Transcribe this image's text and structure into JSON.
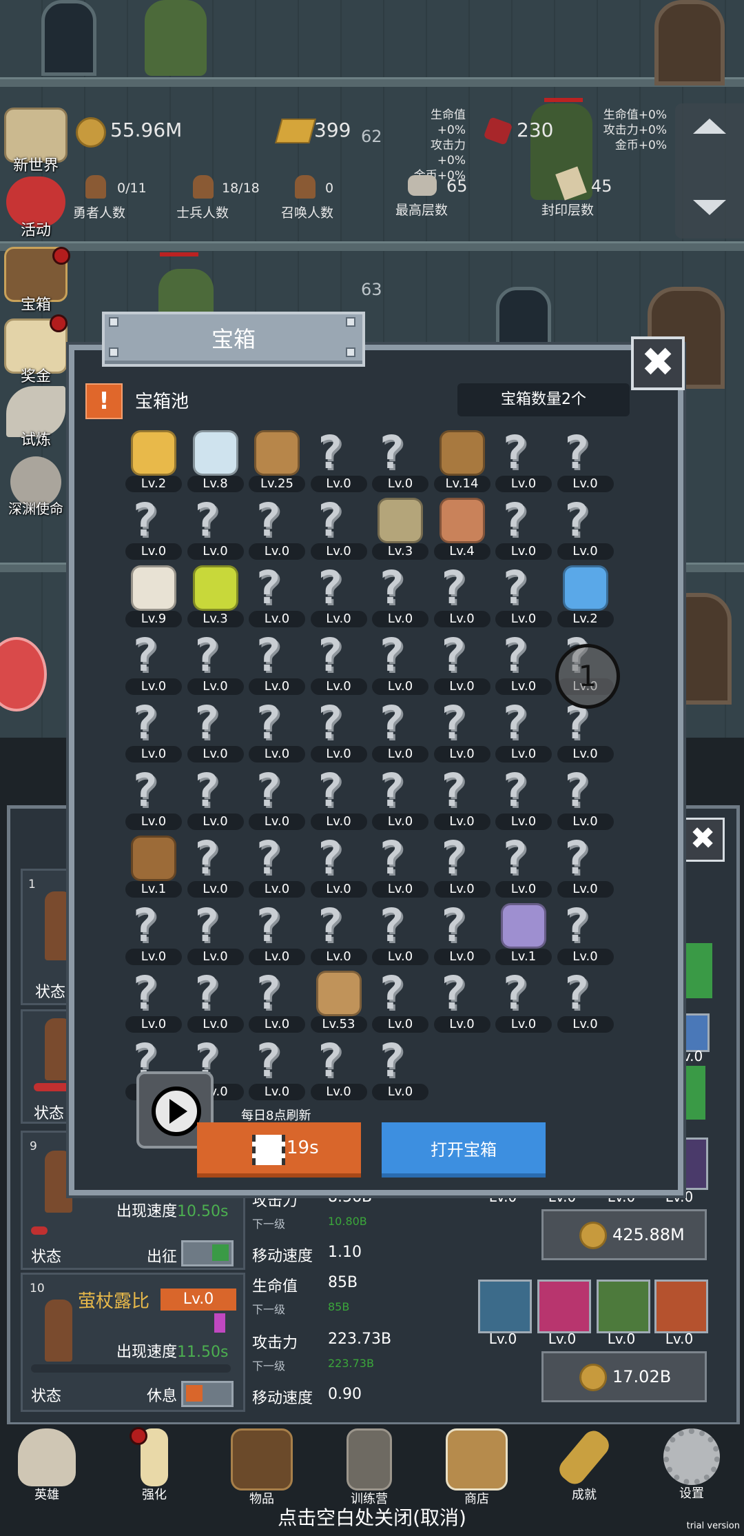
{
  "resources": {
    "gold": "55.96M",
    "gold_bars": "399",
    "gems": "230",
    "floor_62": "62",
    "floor_63": "63",
    "bonus_left": [
      "生命值+0%",
      "攻击力+0%",
      "金币+0%"
    ],
    "bonus_right": [
      "生命值+0%",
      "攻击力+0%",
      "金币+0%"
    ],
    "hero_count": "0/11",
    "hero_count_label": "勇者人数",
    "soldier_count": "18/18",
    "soldier_count_label": "士兵人数",
    "summon_count": "0",
    "summon_count_label": "召唤人数",
    "max_floor": "65",
    "max_floor_label": "最高层数",
    "seal_floor": "45",
    "seal_floor_label": "封印层数"
  },
  "side_menu": [
    {
      "label": "新世界",
      "icon": "map-icon"
    },
    {
      "label": "活动",
      "icon": "heart-icon"
    },
    {
      "label": "宝箱",
      "icon": "chest-icon"
    },
    {
      "label": "奖金",
      "icon": "envelope-icon"
    },
    {
      "label": "试炼",
      "icon": "feather-icon"
    },
    {
      "label": "深渊使命",
      "icon": "orb-icon"
    }
  ],
  "dialog": {
    "title": "宝箱",
    "close_symbol": "✖",
    "pool_icon": "!",
    "pool_title": "宝箱池",
    "chest_count": "宝箱数量2个",
    "refresh_note": "每日8点刷新",
    "video_timer": "19s",
    "open_button": "打开宝箱",
    "crosshair_number": "1",
    "unknown_symbol": "?",
    "items": [
      {
        "icon": "crown-icon",
        "lv": "Lv.2"
      },
      {
        "icon": "diamond-icon",
        "lv": "Lv.8"
      },
      {
        "icon": "sword-icon",
        "lv": "Lv.25"
      },
      {
        "icon": "unknown",
        "lv": "Lv.0"
      },
      {
        "icon": "unknown",
        "lv": "Lv.0"
      },
      {
        "icon": "chest-armor-icon",
        "lv": "Lv.14"
      },
      {
        "icon": "unknown",
        "lv": "Lv.0"
      },
      {
        "icon": "unknown",
        "lv": "Lv.0"
      },
      {
        "icon": "unknown",
        "lv": "Lv.0"
      },
      {
        "icon": "unknown",
        "lv": "Lv.0"
      },
      {
        "icon": "unknown",
        "lv": "Lv.0"
      },
      {
        "icon": "unknown",
        "lv": "Lv.0"
      },
      {
        "icon": "helmet-icon",
        "lv": "Lv.3"
      },
      {
        "icon": "meat-icon",
        "lv": "Lv.4"
      },
      {
        "icon": "unknown",
        "lv": "Lv.0"
      },
      {
        "icon": "unknown",
        "lv": "Lv.0"
      },
      {
        "icon": "rice-bowl-icon",
        "lv": "Lv.9"
      },
      {
        "icon": "green-potion-icon",
        "lv": "Lv.3"
      },
      {
        "icon": "unknown",
        "lv": "Lv.0"
      },
      {
        "icon": "unknown",
        "lv": "Lv.0"
      },
      {
        "icon": "unknown",
        "lv": "Lv.0"
      },
      {
        "icon": "unknown",
        "lv": "Lv.0"
      },
      {
        "icon": "unknown",
        "lv": "Lv.0"
      },
      {
        "icon": "blue-potion-icon",
        "lv": "Lv.2"
      },
      {
        "icon": "unknown",
        "lv": "Lv.0"
      },
      {
        "icon": "unknown",
        "lv": "Lv.0"
      },
      {
        "icon": "unknown",
        "lv": "Lv.0"
      },
      {
        "icon": "unknown",
        "lv": "Lv.0"
      },
      {
        "icon": "unknown",
        "lv": "Lv.0"
      },
      {
        "icon": "unknown",
        "lv": "Lv.0"
      },
      {
        "icon": "unknown",
        "lv": "Lv.0"
      },
      {
        "icon": "unknown",
        "lv": "Lv.0"
      },
      {
        "icon": "unknown",
        "lv": "Lv.0"
      },
      {
        "icon": "unknown",
        "lv": "Lv.0"
      },
      {
        "icon": "unknown",
        "lv": "Lv.0"
      },
      {
        "icon": "unknown",
        "lv": "Lv.0"
      },
      {
        "icon": "unknown",
        "lv": "Lv.0"
      },
      {
        "icon": "unknown",
        "lv": "Lv.0"
      },
      {
        "icon": "unknown",
        "lv": "Lv.0"
      },
      {
        "icon": "unknown",
        "lv": "Lv.0"
      },
      {
        "icon": "unknown",
        "lv": "Lv.0"
      },
      {
        "icon": "unknown",
        "lv": "Lv.0"
      },
      {
        "icon": "unknown",
        "lv": "Lv.0"
      },
      {
        "icon": "unknown",
        "lv": "Lv.0"
      },
      {
        "icon": "unknown",
        "lv": "Lv.0"
      },
      {
        "icon": "unknown",
        "lv": "Lv.0"
      },
      {
        "icon": "unknown",
        "lv": "Lv.0"
      },
      {
        "icon": "unknown",
        "lv": "Lv.0"
      },
      {
        "icon": "backpack-icon",
        "lv": "Lv.1"
      },
      {
        "icon": "unknown",
        "lv": "Lv.0"
      },
      {
        "icon": "unknown",
        "lv": "Lv.0"
      },
      {
        "icon": "unknown",
        "lv": "Lv.0"
      },
      {
        "icon": "unknown",
        "lv": "Lv.0"
      },
      {
        "icon": "unknown",
        "lv": "Lv.0"
      },
      {
        "icon": "unknown",
        "lv": "Lv.0"
      },
      {
        "icon": "unknown",
        "lv": "Lv.0"
      },
      {
        "icon": "unknown",
        "lv": "Lv.0"
      },
      {
        "icon": "unknown",
        "lv": "Lv.0"
      },
      {
        "icon": "unknown",
        "lv": "Lv.0"
      },
      {
        "icon": "unknown",
        "lv": "Lv.0"
      },
      {
        "icon": "unknown",
        "lv": "Lv.0"
      },
      {
        "icon": "unknown",
        "lv": "Lv.0"
      },
      {
        "icon": "gem-cluster-icon",
        "lv": "Lv.1"
      },
      {
        "icon": "unknown",
        "lv": "Lv.0"
      },
      {
        "icon": "unknown",
        "lv": "Lv.0"
      },
      {
        "icon": "unknown",
        "lv": "Lv.0"
      },
      {
        "icon": "unknown",
        "lv": "Lv.0"
      },
      {
        "icon": "beer-mug-icon",
        "lv": "Lv.53"
      },
      {
        "icon": "unknown",
        "lv": "Lv.0"
      },
      {
        "icon": "unknown",
        "lv": "Lv.0"
      },
      {
        "icon": "unknown",
        "lv": "Lv.0"
      },
      {
        "icon": "unknown",
        "lv": "Lv.0"
      },
      {
        "icon": "unknown",
        "lv": "Lv.0"
      },
      {
        "icon": "unknown",
        "lv": "Lv.0"
      },
      {
        "icon": "unknown",
        "lv": "Lv.0"
      },
      {
        "icon": "unknown",
        "lv": "Lv.0"
      },
      {
        "icon": "unknown",
        "lv": "Lv.0"
      }
    ]
  },
  "heroes_panel": {
    "hero1_index": "1",
    "hero9_index": "9",
    "hero10_index": "10",
    "status_label": "状态",
    "hero9_speed_label": "出现速度",
    "hero9_speed": "10.50s",
    "hero9_state": "出征",
    "hero9_atk_label": "攻击力",
    "hero9_atk": "8.56B",
    "hero9_next_label": "下一级",
    "hero9_next": "10.80B",
    "hero9_move_label": "移动速度",
    "hero9_move": "1.10",
    "hero9_cost": "425.88M",
    "hero9_skill_lv": [
      "Lv.0",
      "Lv.0",
      "Lv.0",
      "Lv.0"
    ],
    "hero10_name": "萤杖露比",
    "hero10_lv": "Lv.0",
    "hero10_speed_label": "出现速度",
    "hero10_speed": "11.50s",
    "hero10_state": "休息",
    "hero10_hp_label": "生命值",
    "hero10_hp": "85B",
    "hero10_hp_next_label": "下一级",
    "hero10_hp_next": "85B",
    "hero10_atk_label": "攻击力",
    "hero10_atk": "223.73B",
    "hero10_atk_next_label": "下一级",
    "hero10_atk_next": "223.73B",
    "hero10_move_label": "移动速度",
    "hero10_move": "0.90",
    "hero10_cost": "17.02B",
    "hero10_skill_lv": [
      "Lv.0",
      "Lv.0",
      "Lv.0",
      "Lv.0"
    ],
    "partial_lv": "Lv.0"
  },
  "bottom_nav": [
    {
      "label": "英雄",
      "icon": "skull-icon"
    },
    {
      "label": "强化",
      "icon": "candle-icon"
    },
    {
      "label": "物品",
      "icon": "book-icon"
    },
    {
      "label": "训练营",
      "icon": "lantern-icon"
    },
    {
      "label": "商店",
      "icon": "mug-icon"
    },
    {
      "label": "成就",
      "icon": "key-icon"
    },
    {
      "label": "设置",
      "icon": "gear-icon"
    }
  ],
  "close_hint": "点击空白处关闭(取消)",
  "watermark": "trial version",
  "colors": {
    "accent_orange": "#d9662b",
    "button_blue": "#3d8fe0",
    "speed_green": "#4caf50",
    "gold_text": "#e8b94a"
  }
}
